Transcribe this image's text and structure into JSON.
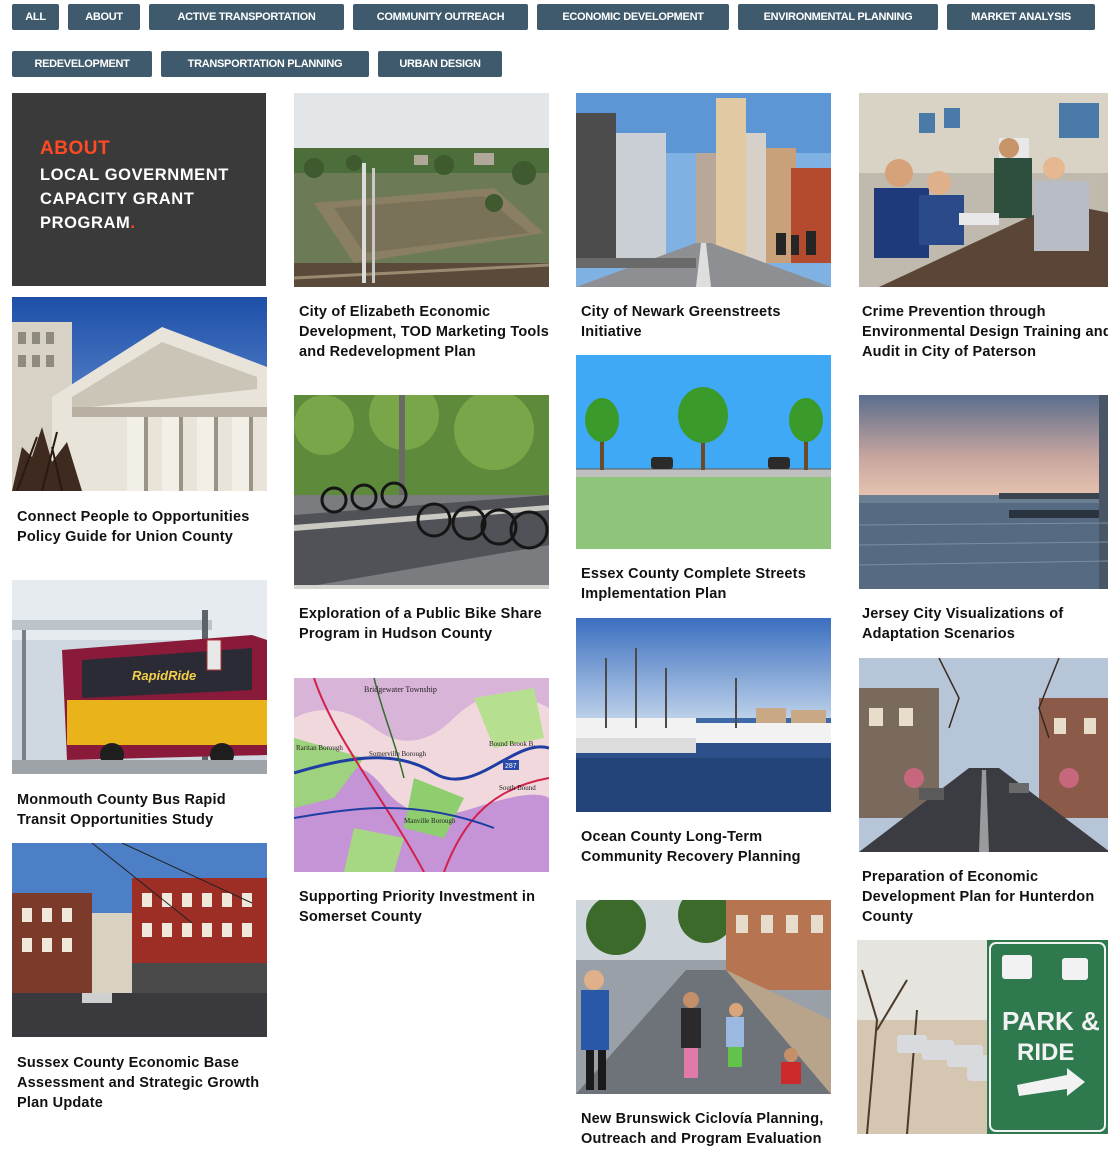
{
  "filters": [
    {
      "label": "ALL"
    },
    {
      "label": "ABOUT"
    },
    {
      "label": "ACTIVE TRANSPORTATION"
    },
    {
      "label": "COMMUNITY OUTREACH"
    },
    {
      "label": "ECONOMIC DEVELOPMENT"
    },
    {
      "label": "ENVIRONMENTAL PLANNING"
    },
    {
      "label": "MARKET ANALYSIS"
    },
    {
      "label": "REDEVELOPMENT"
    },
    {
      "label": "TRANSPORTATION PLANNING"
    },
    {
      "label": "URBAN DESIGN"
    }
  ],
  "about_card": {
    "heading": "ABOUT",
    "line1": "LOCAL GOVERNMENT",
    "line2": "CAPACITY GRANT",
    "line3": "PROGRAM",
    "period": "."
  },
  "projects": {
    "elizabeth": "City of Elizabeth Economic Development, TOD Marketing Tools and Redevelopment Plan",
    "newark": "City of Newark Greenstreets Initiative",
    "paterson": "Crime Prevention through Environmental Design Training and Audit in City of Paterson",
    "union": "Connect People to Opportunities Policy Guide for Union County",
    "hudson_bike": "Exploration of a Public Bike Share Program in Hudson County",
    "essex": "Essex County Complete Streets Implementation Plan",
    "jersey_city": "Jersey City Visualizations of Adaptation Scenarios",
    "monmouth": "Monmouth County Bus Rapid Transit Opportunities Study",
    "ocean": "Ocean County Long-Term Community Recovery Planning",
    "somerset": "Supporting Priority Investment in Somerset County",
    "hunterdon": "Preparation of Economic Development Plan for Hunterdon County",
    "sussex": "Sussex County Economic Base Assessment and Strategic Growth Plan Update",
    "new_brunswick": "New Brunswick Ciclovía Planning, Outreach and Program Evaluation"
  },
  "image_text": {
    "park_ride_1": "PARK &",
    "park_ride_2": "RIDE",
    "bus_sign": "RapidRide",
    "map_town1": "Bridgewater Township",
    "map_town2": "Somerville Borough",
    "map_town3": "Bound Brook B.",
    "map_town4": "Manville Borough",
    "map_town5": "South Bound",
    "map_town6": "Raritan Borough",
    "map_route": "287"
  },
  "colors": {
    "filter_bg": "#3f5a6c",
    "about_bg": "#3a3a3a",
    "about_accent": "#ff4a24"
  }
}
